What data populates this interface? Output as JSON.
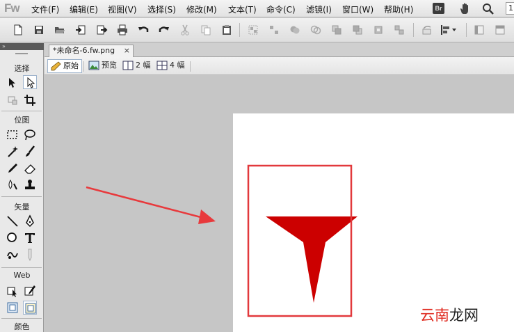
{
  "app": {
    "logo_text": "Fw"
  },
  "menubar": {
    "items": [
      {
        "label": "文件(F)"
      },
      {
        "label": "编辑(E)"
      },
      {
        "label": "视图(V)"
      },
      {
        "label": "选择(S)"
      },
      {
        "label": "修改(M)"
      },
      {
        "label": "文本(T)"
      },
      {
        "label": "命令(C)"
      },
      {
        "label": "滤镜(I)"
      },
      {
        "label": "窗口(W)"
      },
      {
        "label": "帮助(H)"
      }
    ],
    "bridge_label": "Br",
    "zoom_value": "1"
  },
  "toolbar": {
    "icons": [
      "new-document-icon",
      "save-icon",
      "open-icon",
      "import-icon",
      "export-icon",
      "print-icon",
      "undo-icon",
      "redo-icon",
      "cut-icon",
      "copy-icon",
      "paste-icon",
      "group-icon",
      "ungroup-icon",
      "join-icon",
      "split-icon",
      "bring-forward-icon",
      "send-backward-icon",
      "front-icon",
      "back-icon",
      "rotate-icon",
      "align-icon",
      "left-panel-icon",
      "right-panel-icon"
    ]
  },
  "toolpanel": {
    "grip": "»",
    "sections": {
      "select": "选择",
      "bitmap": "位图",
      "vector": "矢量",
      "web": "Web",
      "colors": "颜色"
    }
  },
  "document": {
    "tab_title": "*未命名-6.fw.png",
    "tab_close": "×",
    "views": {
      "original": "原始",
      "preview": "预览",
      "two_up": "2 幅",
      "four_up": "4 幅"
    }
  },
  "canvas": {
    "shape_fill": "#cc0000",
    "highlight_color": "#e2393c",
    "arrow_color": "#e8393c"
  },
  "watermark": {
    "part1": "云南",
    "part2": "龙网"
  }
}
